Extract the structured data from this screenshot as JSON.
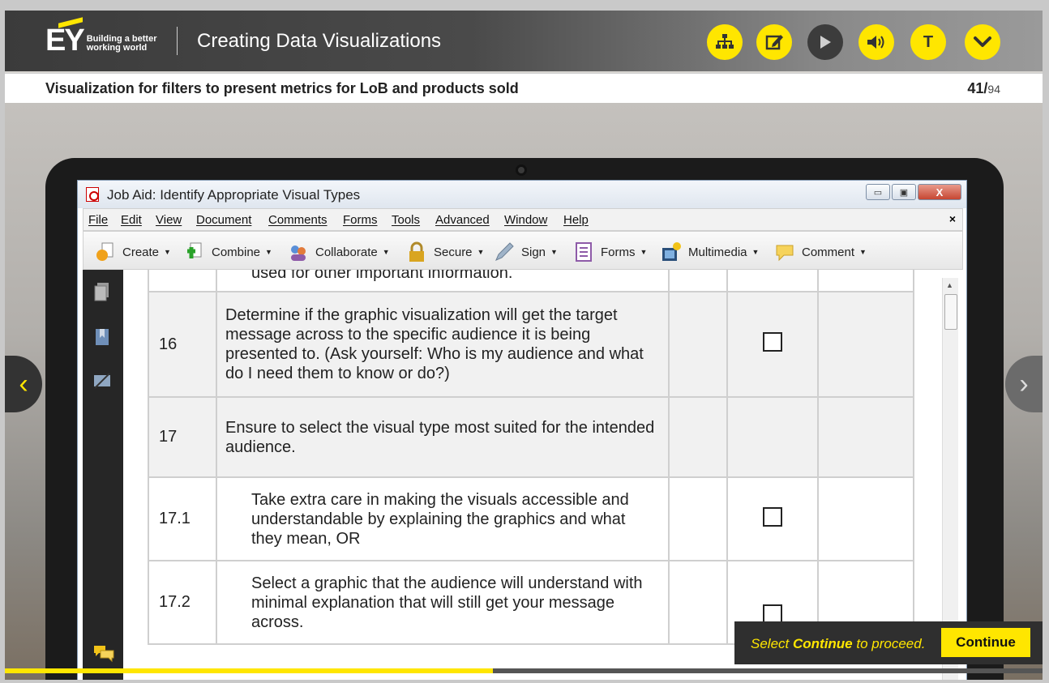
{
  "header": {
    "logo_text": "EY",
    "tagline_line1": "Building a better",
    "tagline_line2": "working world",
    "course_title": "Creating Data Visualizations",
    "buttons": [
      "sitemap-icon",
      "notes-icon",
      "play-icon",
      "audio-icon",
      "T",
      "chevron-down-icon"
    ],
    "text_button_label": "T"
  },
  "slide": {
    "title": "Visualization for filters to present metrics for LoB and products sold",
    "current": "41",
    "sep": "/",
    "total": "94"
  },
  "window": {
    "title": "Job Aid: Identify Appropriate Visual Types",
    "minimize": "▭",
    "restore": "▣",
    "close": "X"
  },
  "menu": [
    "File",
    "Edit",
    "View",
    "Document",
    "Comments",
    "Forms",
    "Tools",
    "Advanced",
    "Window",
    "Help"
  ],
  "menu_close": "×",
  "toolbar": [
    "Create",
    "Combine",
    "Collaborate",
    "Secure",
    "Sign",
    "Forms",
    "Multimedia",
    "Comment"
  ],
  "table": {
    "partial_row_text": "used for other important information.",
    "rows": [
      {
        "num": "16",
        "text": "Determine if the graphic visualization will get the target message across to the specific audience it is being presented to. (Ask yourself: Who is my audience and what do I need them to know or do?)",
        "checkbox": true,
        "shaded": true,
        "sub": false
      },
      {
        "num": "17",
        "text": "Ensure to select the visual type most suited for the intended audience.",
        "checkbox": false,
        "shaded": true,
        "sub": false
      },
      {
        "num": "17.1",
        "text": "Take extra care in making the visuals accessible and understandable by explaining the graphics and what they mean, OR",
        "checkbox": true,
        "shaded": false,
        "sub": true
      },
      {
        "num": "17.2",
        "text": "Select a graphic that the audience will understand with minimal explanation that will still get your message across.",
        "checkbox": true,
        "shaded": false,
        "sub": true
      }
    ]
  },
  "continue": {
    "prefix": "Select ",
    "bold": "Continue",
    "suffix": " to proceed.",
    "button_label": "Continue"
  },
  "nav": {
    "prev": "‹",
    "next": "›"
  },
  "progress": 0.47,
  "colors": {
    "accent": "#ffe600",
    "header_dark": "#3b3b3b",
    "panel": "#2f2f2f"
  }
}
